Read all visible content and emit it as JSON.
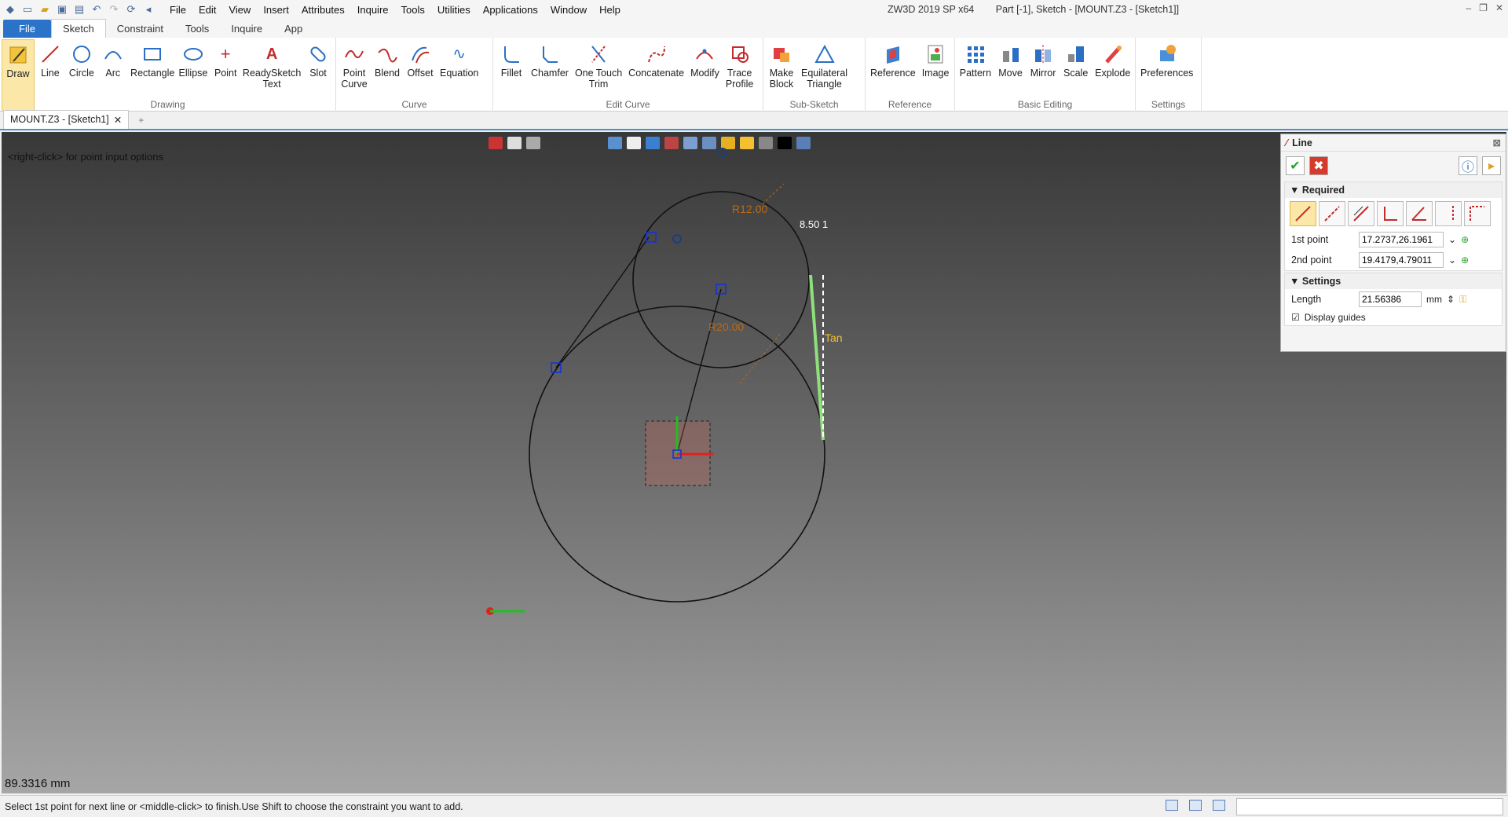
{
  "window": {
    "title": "ZW3D 2019 SP x64",
    "doc_title": "Part [-1],  Sketch - [MOUNT.Z3 - [Sketch1]]"
  },
  "menu": [
    "File",
    "Edit",
    "View",
    "Insert",
    "Attributes",
    "Inquire",
    "Tools",
    "Utilities",
    "Applications",
    "Window",
    "Help"
  ],
  "ribbon_tabs": {
    "file": "File",
    "sketch": "Sketch",
    "constraint": "Constraint",
    "tools": "Tools",
    "inquire": "Inquire",
    "app": "App"
  },
  "groups": {
    "drawing": {
      "label": "Drawing",
      "buttons": [
        "Draw",
        "Line",
        "Circle",
        "Arc",
        "Rectangle",
        "Ellipse",
        "Point",
        "ReadySketch\nText",
        "Slot"
      ]
    },
    "curve": {
      "label": "Curve",
      "buttons": [
        "Point\nCurve",
        "Blend",
        "Offset",
        "Equation"
      ]
    },
    "edit_curve": {
      "label": "Edit Curve",
      "buttons": [
        "Fillet",
        "Chamfer",
        "One Touch\nTrim",
        "Concatenate",
        "Modify",
        "Trace\nProfile"
      ]
    },
    "sub_sketch": {
      "label": "Sub-Sketch",
      "buttons": [
        "Make\nBlock",
        "Equilateral\nTriangle"
      ]
    },
    "reference": {
      "label": "Reference",
      "buttons": [
        "Reference",
        "Image"
      ]
    },
    "basic_editing": {
      "label": "Basic Editing",
      "buttons": [
        "Pattern",
        "Move",
        "Mirror",
        "Scale",
        "Explode"
      ]
    },
    "settings": {
      "label": "Settings",
      "buttons": [
        "Preferences"
      ]
    }
  },
  "doc_tab": {
    "label": "MOUNT.Z3 - [Sketch1]"
  },
  "viewport": {
    "hint": "<right-click> for point input options",
    "measure": "89.3316 mm",
    "dims": {
      "r12": "R12.00",
      "r20": "R20.00",
      "tan": "Tan",
      "len": "8.50 1"
    }
  },
  "panel": {
    "title": "Line",
    "required": "Required",
    "first_point_label": "1st point",
    "first_point_value": "17.2737,26.1961",
    "second_point_label": "2nd point",
    "second_point_value": "19.4179,4.79011",
    "settings": "Settings",
    "length_label": "Length",
    "length_value": "21.56386",
    "length_unit": "mm",
    "display_guides": "Display guides"
  },
  "status": {
    "text": "Select 1st point for next line or <middle-click> to finish.Use Shift to choose the constraint you want to add."
  },
  "colors": {
    "accent": "#2b73c9",
    "selection": "#fbe7a8",
    "line_preview": "#8ee07a",
    "dim": "#b86a1a"
  }
}
